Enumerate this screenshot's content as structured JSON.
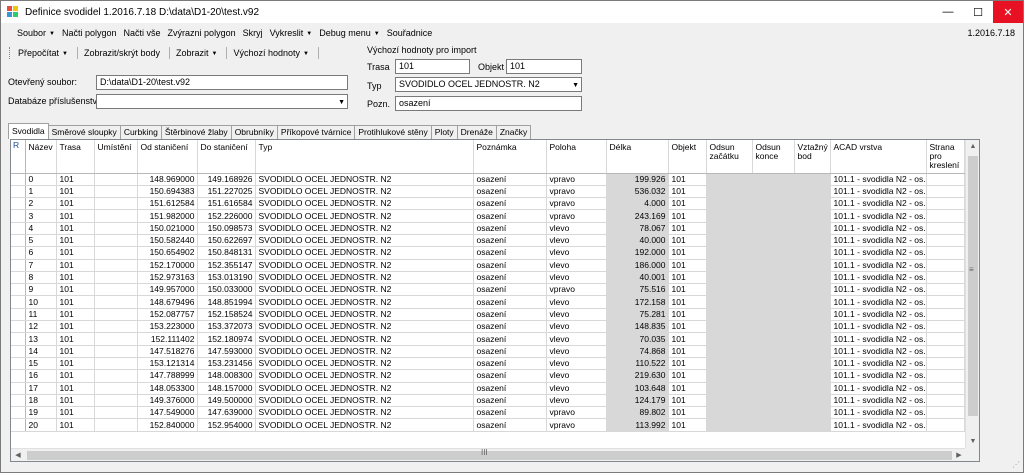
{
  "window": {
    "title": "Definice svodidel 1.2016.7.18 D:\\data\\D1-20\\test.v92",
    "minimize": "—",
    "maximize": "☐",
    "close": "✕"
  },
  "menu": {
    "items": [
      {
        "label": "Soubor",
        "caret": "▼"
      },
      {
        "label": "Načti polygon",
        "caret": ""
      },
      {
        "label": "Načti vše",
        "caret": ""
      },
      {
        "label": "Zvýrazni polygon",
        "caret": ""
      },
      {
        "label": "Skryj",
        "caret": ""
      },
      {
        "label": "Vykreslit",
        "caret": "▼"
      },
      {
        "label": "Debug menu",
        "caret": "▼"
      },
      {
        "label": "Souřadnice",
        "caret": ""
      }
    ],
    "version": "1.2016.7.18"
  },
  "toolbar": {
    "items": [
      {
        "label": "Přepočítat",
        "caret": "▼"
      },
      {
        "label": "Zobrazit/skrýt body",
        "caret": ""
      },
      {
        "label": "Zobrazit",
        "caret": "▼"
      },
      {
        "label": "Výchozí hodnoty",
        "caret": "▼"
      }
    ]
  },
  "form": {
    "opened_file_label": "Otevřený soubor:",
    "opened_file_value": "D:\\data\\D1-20\\test.v92",
    "db_label": "Databáze příslušenství",
    "db_value": "",
    "dropdown_glyph": "▼",
    "defaults_title": "Výchozí hodnoty pro import",
    "trasa_label": "Trasa",
    "trasa_value": "101",
    "objekt_label": "Objekt",
    "objekt_value": "101",
    "typ_label": "Typ",
    "typ_value": "SVODIDLO OCEL JEDNOSTR. N2",
    "pozn_label": "Pozn.",
    "pozn_value": "osazení"
  },
  "tabs": [
    {
      "label": "Svodidla",
      "active": true
    },
    {
      "label": "Směrové sloupky",
      "active": false
    },
    {
      "label": "Curbking",
      "active": false
    },
    {
      "label": "Štěrbinové žlaby",
      "active": false
    },
    {
      "label": "Obrubníky",
      "active": false
    },
    {
      "label": "Příkopové tvárnice",
      "active": false
    },
    {
      "label": "Protihlukové stěny",
      "active": false
    },
    {
      "label": "Ploty",
      "active": false
    },
    {
      "label": "Drenáže",
      "active": false
    },
    {
      "label": "Značky",
      "active": false
    }
  ],
  "grid": {
    "row_header_label": "R",
    "columns": [
      "Název",
      "Trasa",
      "Umístění",
      "Od staničení",
      "Do staničení",
      "Typ",
      "Poznámka",
      "Poloha",
      "Délka",
      "Objekt",
      "Odsun začátku",
      "Odsun konce",
      "Vztažný bod",
      "ACAD vrstva",
      "Strana pro kreslení"
    ],
    "rows": [
      [
        "0",
        "101",
        "",
        "148.969000",
        "149.168926",
        "SVODIDLO OCEL JEDNOSTR. N2",
        "osazení",
        "vpravo",
        "199.926",
        "101",
        "",
        "",
        "",
        "101.1 - svodidla N2 - os...",
        ""
      ],
      [
        "1",
        "101",
        "",
        "150.694383",
        "151.227025",
        "SVODIDLO OCEL JEDNOSTR. N2",
        "osazení",
        "vpravo",
        "536.032",
        "101",
        "",
        "",
        "",
        "101.1 - svodidla N2 - os...",
        ""
      ],
      [
        "2",
        "101",
        "",
        "151.612584",
        "151.616584",
        "SVODIDLO OCEL JEDNOSTR. N2",
        "osazení",
        "vpravo",
        "4.000",
        "101",
        "",
        "",
        "",
        "101.1 - svodidla N2 - os...",
        ""
      ],
      [
        "3",
        "101",
        "",
        "151.982000",
        "152.226000",
        "SVODIDLO OCEL JEDNOSTR. N2",
        "osazení",
        "vpravo",
        "243.169",
        "101",
        "",
        "",
        "",
        "101.1 - svodidla N2 - os...",
        ""
      ],
      [
        "4",
        "101",
        "",
        "150.021000",
        "150.098573",
        "SVODIDLO OCEL JEDNOSTR. N2",
        "osazení",
        "vlevo",
        "78.067",
        "101",
        "",
        "",
        "",
        "101.1 - svodidla N2 - os...",
        ""
      ],
      [
        "5",
        "101",
        "",
        "150.582440",
        "150.622697",
        "SVODIDLO OCEL JEDNOSTR. N2",
        "osazení",
        "vlevo",
        "40.000",
        "101",
        "",
        "",
        "",
        "101.1 - svodidla N2 - os...",
        ""
      ],
      [
        "6",
        "101",
        "",
        "150.654902",
        "150.848131",
        "SVODIDLO OCEL JEDNOSTR. N2",
        "osazení",
        "vlevo",
        "192.000",
        "101",
        "",
        "",
        "",
        "101.1 - svodidla N2 - os...",
        ""
      ],
      [
        "7",
        "101",
        "",
        "152.170000",
        "152.355147",
        "SVODIDLO OCEL JEDNOSTR. N2",
        "osazení",
        "vlevo",
        "186.000",
        "101",
        "",
        "",
        "",
        "101.1 - svodidla N2 - os...",
        ""
      ],
      [
        "8",
        "101",
        "",
        "152.973163",
        "153.013190",
        "SVODIDLO OCEL JEDNOSTR. N2",
        "osazení",
        "vlevo",
        "40.001",
        "101",
        "",
        "",
        "",
        "101.1 - svodidla N2 - os...",
        ""
      ],
      [
        "9",
        "101",
        "",
        "149.957000",
        "150.033000",
        "SVODIDLO OCEL JEDNOSTR. N2",
        "osazení",
        "vpravo",
        "75.516",
        "101",
        "",
        "",
        "",
        "101.1 - svodidla N2 - os...",
        ""
      ],
      [
        "10",
        "101",
        "",
        "148.679496",
        "148.851994",
        "SVODIDLO OCEL JEDNOSTR. N2",
        "osazení",
        "vlevo",
        "172.158",
        "101",
        "",
        "",
        "",
        "101.1 - svodidla N2 - os...",
        ""
      ],
      [
        "11",
        "101",
        "",
        "152.087757",
        "152.158524",
        "SVODIDLO OCEL JEDNOSTR. N2",
        "osazení",
        "vlevo",
        "75.281",
        "101",
        "",
        "",
        "",
        "101.1 - svodidla N2 - os...",
        ""
      ],
      [
        "12",
        "101",
        "",
        "153.223000",
        "153.372073",
        "SVODIDLO OCEL JEDNOSTR. N2",
        "osazení",
        "vlevo",
        "148.835",
        "101",
        "",
        "",
        "",
        "101.1 - svodidla N2 - os...",
        ""
      ],
      [
        "13",
        "101",
        "",
        "152.111402",
        "152.180974",
        "SVODIDLO OCEL JEDNOSTR. N2",
        "osazení",
        "vlevo",
        "70.035",
        "101",
        "",
        "",
        "",
        "101.1 - svodidla N2 - os...",
        ""
      ],
      [
        "14",
        "101",
        "",
        "147.518276",
        "147.593000",
        "SVODIDLO OCEL JEDNOSTR. N2",
        "osazení",
        "vlevo",
        "74.868",
        "101",
        "",
        "",
        "",
        "101.1 - svodidla N2 - os...",
        ""
      ],
      [
        "15",
        "101",
        "",
        "153.121314",
        "153.231456",
        "SVODIDLO OCEL JEDNOSTR. N2",
        "osazení",
        "vlevo",
        "110.522",
        "101",
        "",
        "",
        "",
        "101.1 - svodidla N2 - os...",
        ""
      ],
      [
        "16",
        "101",
        "",
        "147.788999",
        "148.008300",
        "SVODIDLO OCEL JEDNOSTR. N2",
        "osazení",
        "vlevo",
        "219.630",
        "101",
        "",
        "",
        "",
        "101.1 - svodidla N2 - os...",
        ""
      ],
      [
        "17",
        "101",
        "",
        "148.053300",
        "148.157000",
        "SVODIDLO OCEL JEDNOSTR. N2",
        "osazení",
        "vlevo",
        "103.648",
        "101",
        "",
        "",
        "",
        "101.1 - svodidla N2 - os...",
        ""
      ],
      [
        "18",
        "101",
        "",
        "149.376000",
        "149.500000",
        "SVODIDLO OCEL JEDNOSTR. N2",
        "osazení",
        "vlevo",
        "124.179",
        "101",
        "",
        "",
        "",
        "101.1 - svodidla N2 - os...",
        ""
      ],
      [
        "19",
        "101",
        "",
        "147.549000",
        "147.639000",
        "SVODIDLO OCEL JEDNOSTR. N2",
        "osazení",
        "vpravo",
        "89.802",
        "101",
        "",
        "",
        "",
        "101.1 - svodidla N2 - os...",
        ""
      ],
      [
        "20",
        "101",
        "",
        "152.840000",
        "152.954000",
        "SVODIDLO OCEL JEDNOSTR. N2",
        "osazení",
        "vpravo",
        "113.992",
        "101",
        "",
        "",
        "",
        "101.1 - svodidla N2 - os...",
        ""
      ]
    ]
  },
  "scroll": {
    "up": "▲",
    "down": "▼",
    "left": "◀",
    "right": "▶",
    "thumb_grip_v": "≡",
    "thumb_grip_h": "III"
  },
  "colors": {
    "selected_row_header": "#1a4f9c",
    "readonly_cell": "#d8d8d8",
    "close_button": "#e81123"
  }
}
